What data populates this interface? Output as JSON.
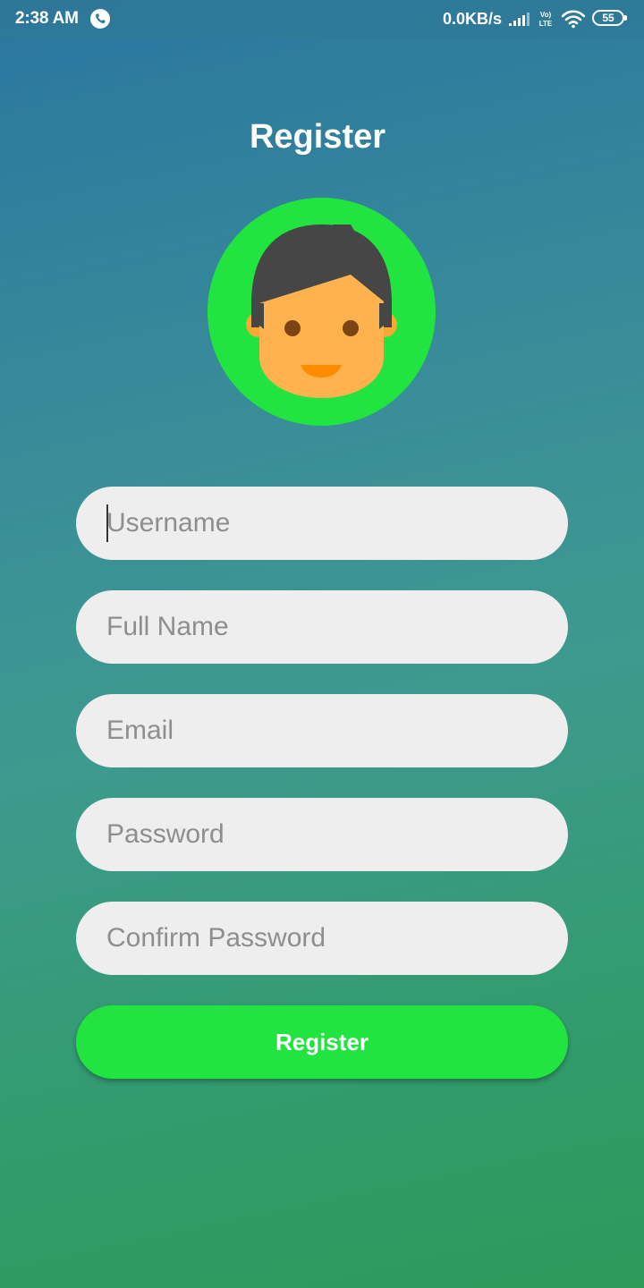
{
  "status_bar": {
    "time": "2:38 AM",
    "net_speed": "0.0KB/s",
    "battery": "55",
    "icons": [
      "call-icon",
      "signal-icon",
      "volte-icon",
      "wifi-icon",
      "battery-icon"
    ]
  },
  "page": {
    "title": "Register"
  },
  "avatar": {
    "icon": "user-avatar-icon",
    "ring_color": "#22e440"
  },
  "form": {
    "username": {
      "placeholder": "Username",
      "value": ""
    },
    "full_name": {
      "placeholder": "Full Name",
      "value": ""
    },
    "email": {
      "placeholder": "Email",
      "value": ""
    },
    "password": {
      "placeholder": "Password",
      "value": ""
    },
    "confirm_password": {
      "placeholder": "Confirm Password",
      "value": ""
    },
    "submit_label": "Register"
  },
  "colors": {
    "accent": "#22e440",
    "input_bg": "#eeeeee",
    "placeholder": "#8e8e8e"
  }
}
